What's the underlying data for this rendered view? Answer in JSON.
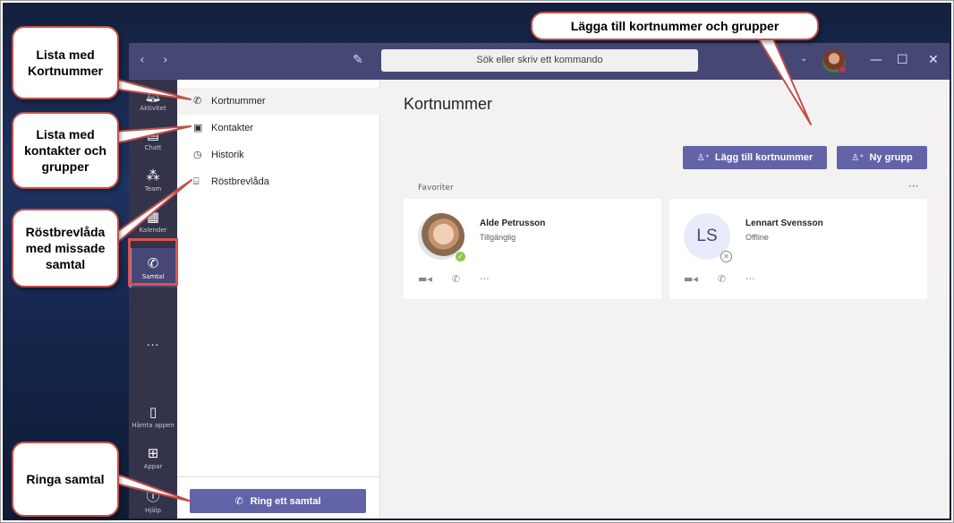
{
  "titlebar": {
    "search_placeholder": "Sök eller skriv ett kommando",
    "nav_back_icon": "chevron-left-icon",
    "nav_forward_icon": "chevron-right-icon",
    "compose_icon": "compose-icon"
  },
  "rail": {
    "items": [
      {
        "label": "Aktivitet",
        "icon": "bell-icon"
      },
      {
        "label": "Chatt",
        "icon": "chat-icon"
      },
      {
        "label": "Team",
        "icon": "team-icon"
      },
      {
        "label": "Kalender",
        "icon": "calendar-icon"
      },
      {
        "label": "Samtal",
        "icon": "phone-icon"
      },
      {
        "label": "Hämta appen",
        "icon": "mobile-icon"
      },
      {
        "label": "Appar",
        "icon": "apps-icon"
      },
      {
        "label": "Hjälp",
        "icon": "help-icon"
      }
    ],
    "more_label": "..."
  },
  "side": {
    "items": [
      {
        "label": "Kortnummer",
        "icon": "phone-icon"
      },
      {
        "label": "Kontakter",
        "icon": "contacts-icon"
      },
      {
        "label": "Historik",
        "icon": "clock-icon"
      },
      {
        "label": "Röstbrevlåda",
        "icon": "voicemail-icon"
      }
    ],
    "ring_label": "Ring ett samtal"
  },
  "main": {
    "title": "Kortnummer",
    "add_label": "Lägg till kortnummer",
    "group_label": "Ny grupp",
    "favorites_label": "Favoriter",
    "cards": [
      {
        "name": "Alde Petrusson",
        "status": "Tillgänglig",
        "initials": ""
      },
      {
        "name": "Lennart Svensson",
        "status": "Offline",
        "initials": "LS"
      }
    ]
  },
  "callouts": {
    "speed_dial": "Lista med Kortnummer",
    "contacts": "Lista med kontakter och grupper",
    "voicemail": "Röstbrevlåda med missade samtal",
    "call": "Ringa samtal",
    "add": "Lägga till kortnummer och grupper"
  },
  "colors": {
    "brand": "#6264a7",
    "titlebar": "#464775",
    "rail": "#33344a",
    "callout_border": "#c0504d",
    "available": "#92c353"
  }
}
